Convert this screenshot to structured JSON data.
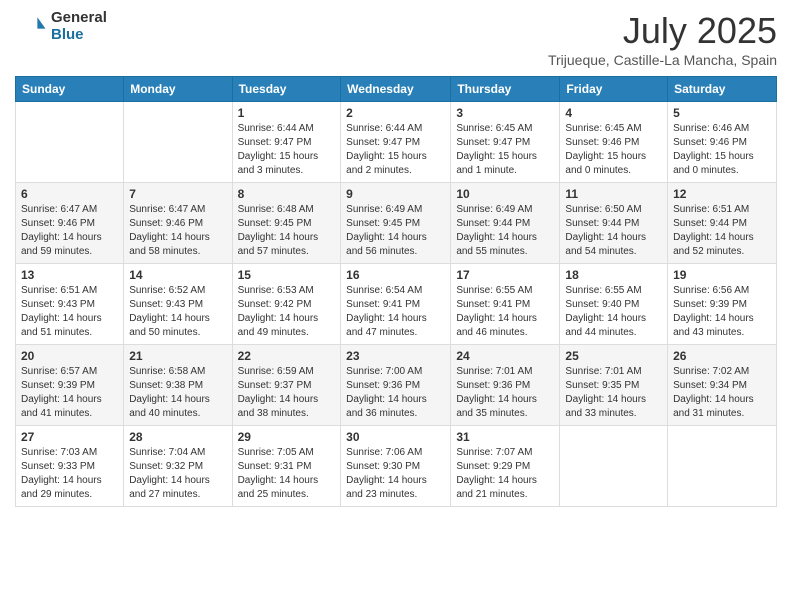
{
  "logo": {
    "general": "General",
    "blue": "Blue"
  },
  "title": "July 2025",
  "location": "Trijueque, Castille-La Mancha, Spain",
  "days_of_week": [
    "Sunday",
    "Monday",
    "Tuesday",
    "Wednesday",
    "Thursday",
    "Friday",
    "Saturday"
  ],
  "weeks": [
    [
      {
        "day": "",
        "detail": ""
      },
      {
        "day": "",
        "detail": ""
      },
      {
        "day": "1",
        "detail": "Sunrise: 6:44 AM\nSunset: 9:47 PM\nDaylight: 15 hours\nand 3 minutes."
      },
      {
        "day": "2",
        "detail": "Sunrise: 6:44 AM\nSunset: 9:47 PM\nDaylight: 15 hours\nand 2 minutes."
      },
      {
        "day": "3",
        "detail": "Sunrise: 6:45 AM\nSunset: 9:47 PM\nDaylight: 15 hours\nand 1 minute."
      },
      {
        "day": "4",
        "detail": "Sunrise: 6:45 AM\nSunset: 9:46 PM\nDaylight: 15 hours\nand 0 minutes."
      },
      {
        "day": "5",
        "detail": "Sunrise: 6:46 AM\nSunset: 9:46 PM\nDaylight: 15 hours\nand 0 minutes."
      }
    ],
    [
      {
        "day": "6",
        "detail": "Sunrise: 6:47 AM\nSunset: 9:46 PM\nDaylight: 14 hours\nand 59 minutes."
      },
      {
        "day": "7",
        "detail": "Sunrise: 6:47 AM\nSunset: 9:46 PM\nDaylight: 14 hours\nand 58 minutes."
      },
      {
        "day": "8",
        "detail": "Sunrise: 6:48 AM\nSunset: 9:45 PM\nDaylight: 14 hours\nand 57 minutes."
      },
      {
        "day": "9",
        "detail": "Sunrise: 6:49 AM\nSunset: 9:45 PM\nDaylight: 14 hours\nand 56 minutes."
      },
      {
        "day": "10",
        "detail": "Sunrise: 6:49 AM\nSunset: 9:44 PM\nDaylight: 14 hours\nand 55 minutes."
      },
      {
        "day": "11",
        "detail": "Sunrise: 6:50 AM\nSunset: 9:44 PM\nDaylight: 14 hours\nand 54 minutes."
      },
      {
        "day": "12",
        "detail": "Sunrise: 6:51 AM\nSunset: 9:44 PM\nDaylight: 14 hours\nand 52 minutes."
      }
    ],
    [
      {
        "day": "13",
        "detail": "Sunrise: 6:51 AM\nSunset: 9:43 PM\nDaylight: 14 hours\nand 51 minutes."
      },
      {
        "day": "14",
        "detail": "Sunrise: 6:52 AM\nSunset: 9:43 PM\nDaylight: 14 hours\nand 50 minutes."
      },
      {
        "day": "15",
        "detail": "Sunrise: 6:53 AM\nSunset: 9:42 PM\nDaylight: 14 hours\nand 49 minutes."
      },
      {
        "day": "16",
        "detail": "Sunrise: 6:54 AM\nSunset: 9:41 PM\nDaylight: 14 hours\nand 47 minutes."
      },
      {
        "day": "17",
        "detail": "Sunrise: 6:55 AM\nSunset: 9:41 PM\nDaylight: 14 hours\nand 46 minutes."
      },
      {
        "day": "18",
        "detail": "Sunrise: 6:55 AM\nSunset: 9:40 PM\nDaylight: 14 hours\nand 44 minutes."
      },
      {
        "day": "19",
        "detail": "Sunrise: 6:56 AM\nSunset: 9:39 PM\nDaylight: 14 hours\nand 43 minutes."
      }
    ],
    [
      {
        "day": "20",
        "detail": "Sunrise: 6:57 AM\nSunset: 9:39 PM\nDaylight: 14 hours\nand 41 minutes."
      },
      {
        "day": "21",
        "detail": "Sunrise: 6:58 AM\nSunset: 9:38 PM\nDaylight: 14 hours\nand 40 minutes."
      },
      {
        "day": "22",
        "detail": "Sunrise: 6:59 AM\nSunset: 9:37 PM\nDaylight: 14 hours\nand 38 minutes."
      },
      {
        "day": "23",
        "detail": "Sunrise: 7:00 AM\nSunset: 9:36 PM\nDaylight: 14 hours\nand 36 minutes."
      },
      {
        "day": "24",
        "detail": "Sunrise: 7:01 AM\nSunset: 9:36 PM\nDaylight: 14 hours\nand 35 minutes."
      },
      {
        "day": "25",
        "detail": "Sunrise: 7:01 AM\nSunset: 9:35 PM\nDaylight: 14 hours\nand 33 minutes."
      },
      {
        "day": "26",
        "detail": "Sunrise: 7:02 AM\nSunset: 9:34 PM\nDaylight: 14 hours\nand 31 minutes."
      }
    ],
    [
      {
        "day": "27",
        "detail": "Sunrise: 7:03 AM\nSunset: 9:33 PM\nDaylight: 14 hours\nand 29 minutes."
      },
      {
        "day": "28",
        "detail": "Sunrise: 7:04 AM\nSunset: 9:32 PM\nDaylight: 14 hours\nand 27 minutes."
      },
      {
        "day": "29",
        "detail": "Sunrise: 7:05 AM\nSunset: 9:31 PM\nDaylight: 14 hours\nand 25 minutes."
      },
      {
        "day": "30",
        "detail": "Sunrise: 7:06 AM\nSunset: 9:30 PM\nDaylight: 14 hours\nand 23 minutes."
      },
      {
        "day": "31",
        "detail": "Sunrise: 7:07 AM\nSunset: 9:29 PM\nDaylight: 14 hours\nand 21 minutes."
      },
      {
        "day": "",
        "detail": ""
      },
      {
        "day": "",
        "detail": ""
      }
    ]
  ]
}
